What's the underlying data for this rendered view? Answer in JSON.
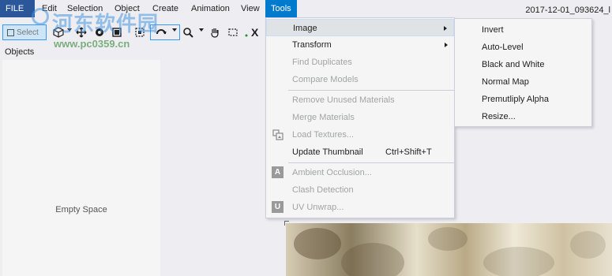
{
  "menubar": {
    "items": [
      "FILE",
      "Edit",
      "Selection",
      "Object",
      "Create",
      "Animation",
      "View",
      "Tools"
    ],
    "doc_title": "2017-12-01_093624_l"
  },
  "toolbar": {
    "select_label": "Select",
    "close_label": "X"
  },
  "watermark": {
    "title": "河东软件园",
    "url": "www.pc0359.cn"
  },
  "objects_panel": {
    "label": "Objects",
    "empty_text": "Empty Space"
  },
  "tools_menu": {
    "items": [
      {
        "label": "Image",
        "enabled": true,
        "submenu": true,
        "highlighted": true
      },
      {
        "label": "Transform",
        "enabled": true,
        "submenu": true
      },
      {
        "label": "Find Duplicates",
        "enabled": false
      },
      {
        "label": "Compare Models",
        "enabled": false
      },
      {
        "label": "Remove Unused Materials",
        "enabled": false
      },
      {
        "label": "Merge Materials",
        "enabled": false
      },
      {
        "label": "Load Textures...",
        "enabled": false,
        "icon": "load-textures-icon"
      },
      {
        "label": "Update Thumbnail",
        "enabled": true,
        "shortcut": "Ctrl+Shift+T"
      },
      {
        "label": "Ambient Occlusion...",
        "enabled": false,
        "icon": "ambient-occlusion-icon",
        "icon_letter": "A"
      },
      {
        "label": "Clash Detection",
        "enabled": false
      },
      {
        "label": "UV Unwrap...",
        "enabled": false,
        "icon": "uv-unwrap-icon",
        "icon_letter": "U"
      }
    ]
  },
  "image_submenu": {
    "items": [
      "Invert",
      "Auto-Level",
      "Black and White",
      "Normal Map",
      "Premutliply Alpha",
      "Resize..."
    ]
  },
  "colors": {
    "menu_active": "#007acc",
    "file_tab": "#2b579a",
    "menu_bg": "#f5f5f5",
    "disabled_text": "#a2a4a5"
  }
}
